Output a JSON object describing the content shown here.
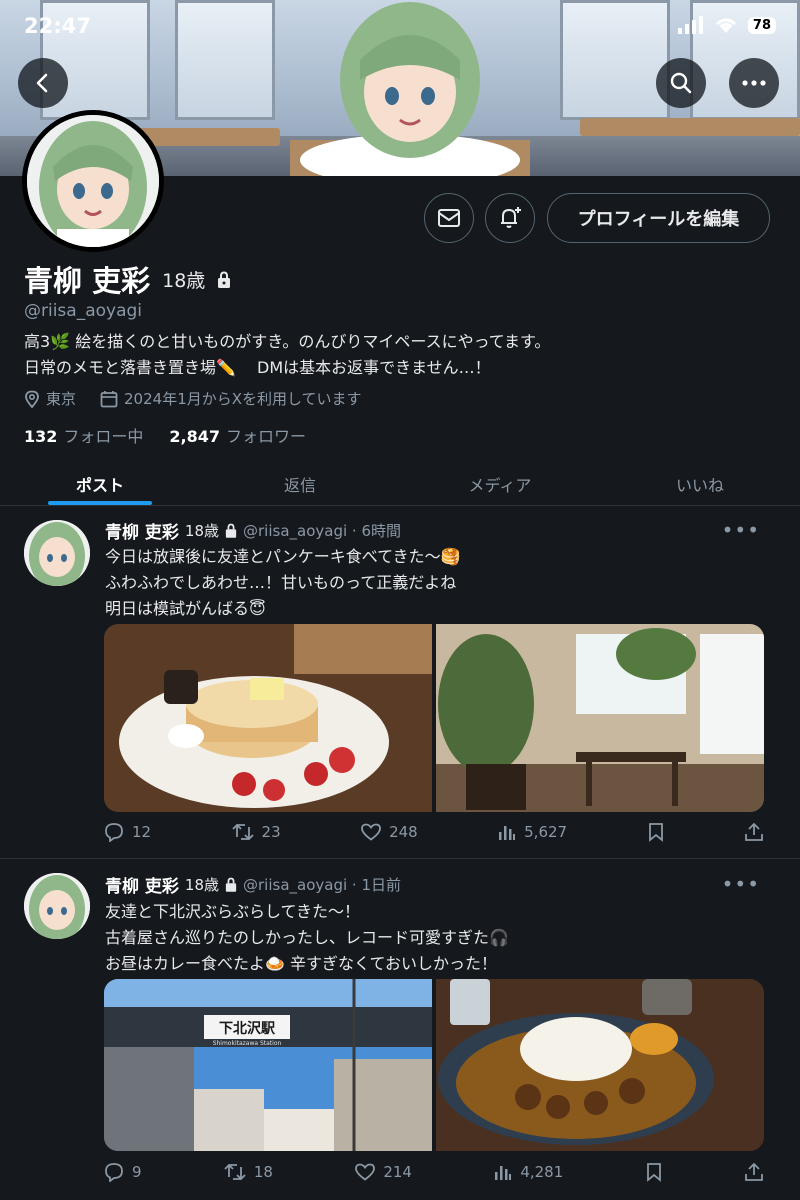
{
  "status_bar": {
    "time": "22:47",
    "battery": "78"
  },
  "profile": {
    "name": "青柳 吏彩",
    "age": "18歳",
    "handle": "@riisa_aoyagi",
    "bio_line1": "高3🌿 絵を描くのと甘いものがすき。のんびりマイペースにやってます。",
    "bio_line2": "日常のメモと落書き置き場✏️　 DMは基本お返事できません…！",
    "location": "東京",
    "joined": "2024年1月からXを利用しています",
    "following_count": "132",
    "following_label": "フォロー中",
    "followers_count": "2,847",
    "followers_label": "フォロワー",
    "edit_button": "プロフィールを編集"
  },
  "tabs": [
    {
      "label": "ポスト",
      "active": true
    },
    {
      "label": "返信"
    },
    {
      "label": "メディア"
    },
    {
      "label": "いいね"
    }
  ],
  "posts": [
    {
      "name": "青柳 吏彩",
      "age": "18歳",
      "meta": "@riisa_aoyagi · 6時間",
      "lines": [
        "今日は放課後に友達とパンケーキ食べてきた〜🥞",
        "ふわふわでしあわせ…！甘いものって正義だよね",
        "明日は模試がんばる😇"
      ],
      "replies": "12",
      "reposts": "23",
      "likes": "248",
      "views": "5,627"
    },
    {
      "name": "青柳 吏彩",
      "age": "18歳",
      "meta": "@riisa_aoyagi · 1日前",
      "lines": [
        "友達と下北沢ぶらぶらしてきた〜！",
        "古着屋さん巡りたのしかったし、レコード可愛すぎた🎧",
        "お昼はカレー食べたよ🍛 辛すぎなくておいしかった！"
      ],
      "station_sign": "下北沢駅",
      "station_sign_sub": "Shimokitazawa Station",
      "replies": "9",
      "reposts": "18",
      "likes": "214",
      "views": "4,281"
    }
  ],
  "colors": {
    "accent": "#1d9bf0",
    "bg": "#15181c",
    "muted": "#8b98a5",
    "border": "#2f3336"
  }
}
